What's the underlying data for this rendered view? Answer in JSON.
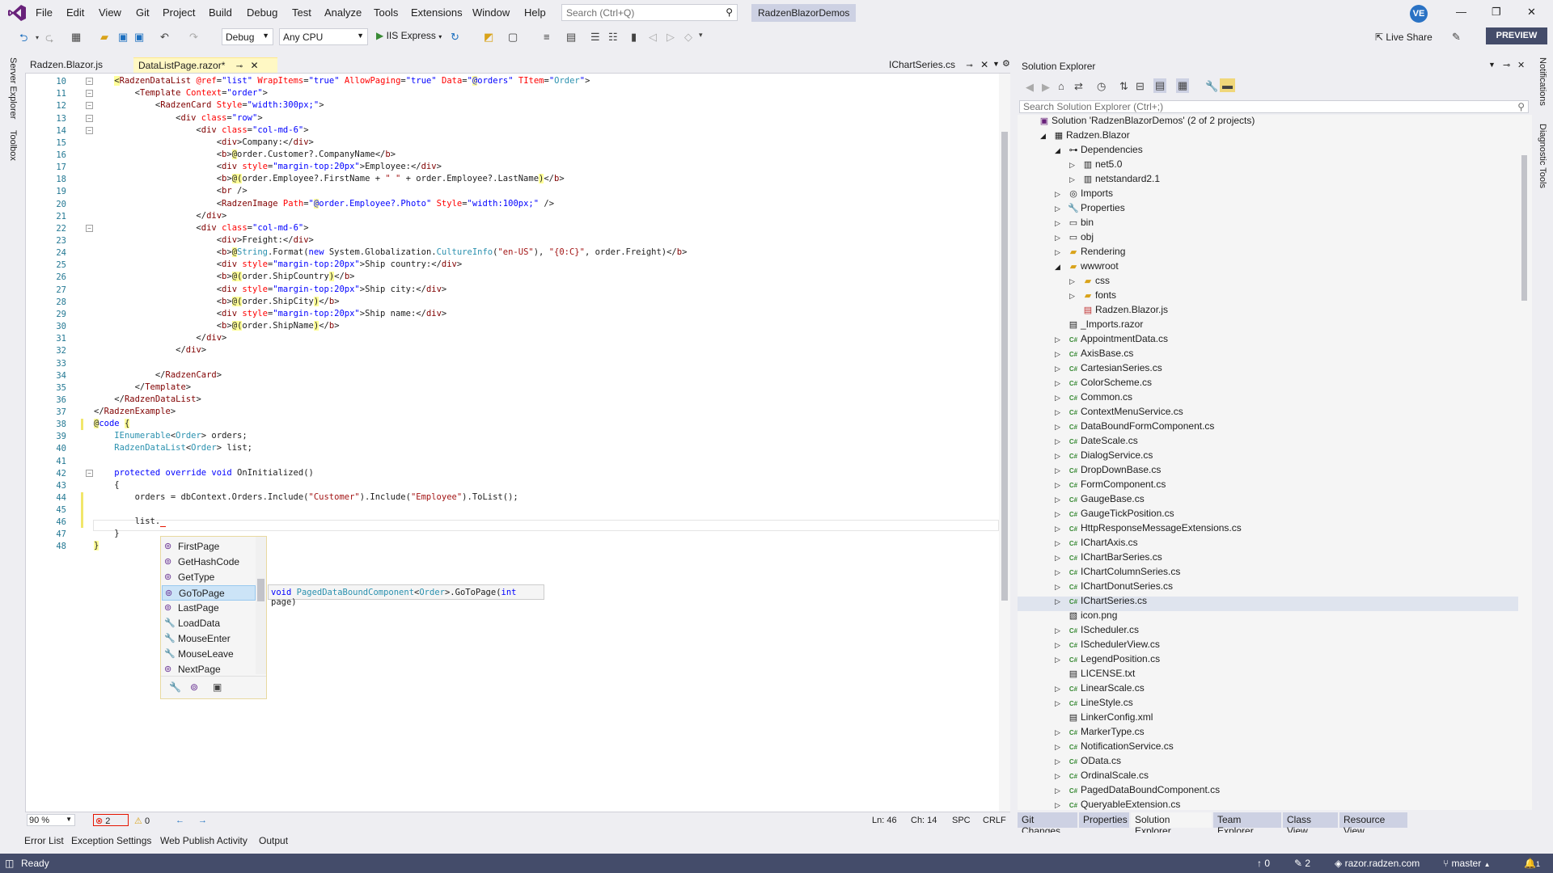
{
  "menu": [
    "File",
    "Edit",
    "View",
    "Git",
    "Project",
    "Build",
    "Debug",
    "Test",
    "Analyze",
    "Tools",
    "Extensions",
    "Window",
    "Help"
  ],
  "search": {
    "placeholder": "Search (Ctrl+Q)"
  },
  "solution_name": "RadzenBlazorDemos",
  "user_initials": "VE",
  "toolbar": {
    "config": "Debug",
    "platform": "Any CPU",
    "run_target": "IIS Express",
    "live_share": "Live Share",
    "preview": "PREVIEW"
  },
  "left_vtabs": [
    "Server Explorer",
    "Toolbox"
  ],
  "right_vtabs": [
    "Notifications",
    "Diagnostic Tools"
  ],
  "editor": {
    "tabs": [
      {
        "label": "Radzen.Blazor.js",
        "active": false
      },
      {
        "label": "DataListPage.razor*",
        "active": true
      },
      {
        "label": "IChartSeries.cs",
        "active": false
      }
    ],
    "line_numbers": [
      "10",
      "11",
      "12",
      "13",
      "14",
      "15",
      "16",
      "17",
      "18",
      "19",
      "20",
      "21",
      "22",
      "23",
      "24",
      "25",
      "26",
      "27",
      "28",
      "29",
      "30",
      "31",
      "32",
      "33",
      "34",
      "35",
      "36",
      "37",
      "38",
      "39",
      "40",
      "41",
      "42",
      "43",
      "44",
      "45",
      "46",
      "47",
      "48"
    ]
  },
  "completion": {
    "items": [
      "FirstPage",
      "GetHashCode",
      "GetType",
      "GoToPage",
      "LastPage",
      "LoadData",
      "MouseEnter",
      "MouseLeave",
      "NextPage"
    ],
    "selected": "GoToPage",
    "tooltip": {
      "ret": "void",
      "cls": "PagedDataBoundComponent",
      "gen": "Order",
      "method": ".GoToPage(",
      "ptype": "int",
      "pname": " page)"
    }
  },
  "editor_status": {
    "zoom": "90 %",
    "errors": "2",
    "warnings": "0",
    "ln": "Ln: 46",
    "ch": "Ch: 14",
    "spc": "SPC",
    "crlf": "CRLF"
  },
  "solution_explorer": {
    "title": "Solution Explorer",
    "search_placeholder": "Search Solution Explorer (Ctrl+;)",
    "nodes": [
      {
        "label": "Solution 'RadzenBlazorDemos' (2 of 2 projects)",
        "depth": 0,
        "icon": "solution-icon",
        "expander": ""
      },
      {
        "label": "Radzen.Blazor",
        "depth": 1,
        "icon": "project-icon",
        "expander": "◢"
      },
      {
        "label": "Dependencies",
        "depth": 2,
        "icon": "dependencies-icon",
        "expander": "◢"
      },
      {
        "label": "net5.0",
        "depth": 3,
        "icon": "framework-icon",
        "expander": "▷"
      },
      {
        "label": "netstandard2.1",
        "depth": 3,
        "icon": "framework-icon",
        "expander": "▷"
      },
      {
        "label": "Imports",
        "depth": 2,
        "icon": "imports-icon",
        "expander": "▷"
      },
      {
        "label": "Properties",
        "depth": 2,
        "icon": "properties-icon",
        "expander": "▷"
      },
      {
        "label": "bin",
        "depth": 2,
        "icon": "folder-outline-icon",
        "expander": "▷"
      },
      {
        "label": "obj",
        "depth": 2,
        "icon": "folder-outline-icon",
        "expander": "▷"
      },
      {
        "label": "Rendering",
        "depth": 2,
        "icon": "folder-icon",
        "expander": "▷"
      },
      {
        "label": "wwwroot",
        "depth": 2,
        "icon": "web-folder-icon",
        "expander": "◢"
      },
      {
        "label": "css",
        "depth": 3,
        "icon": "folder-icon",
        "expander": "▷"
      },
      {
        "label": "fonts",
        "depth": 3,
        "icon": "folder-icon",
        "expander": "▷"
      },
      {
        "label": "Radzen.Blazor.js",
        "depth": 3,
        "icon": "js-file-icon",
        "expander": ""
      },
      {
        "label": "_Imports.razor",
        "depth": 2,
        "icon": "razor-file-icon",
        "expander": ""
      },
      {
        "label": "AppointmentData.cs",
        "depth": 2,
        "icon": "cs-file-icon",
        "expander": "▷"
      },
      {
        "label": "AxisBase.cs",
        "depth": 2,
        "icon": "cs-file-icon",
        "expander": "▷"
      },
      {
        "label": "CartesianSeries.cs",
        "depth": 2,
        "icon": "cs-file-icon",
        "expander": "▷"
      },
      {
        "label": "ColorScheme.cs",
        "depth": 2,
        "icon": "cs-file-icon",
        "expander": "▷"
      },
      {
        "label": "Common.cs",
        "depth": 2,
        "icon": "cs-file-icon",
        "expander": "▷"
      },
      {
        "label": "ContextMenuService.cs",
        "depth": 2,
        "icon": "cs-file-icon",
        "expander": "▷"
      },
      {
        "label": "DataBoundFormComponent.cs",
        "depth": 2,
        "icon": "cs-file-icon",
        "expander": "▷"
      },
      {
        "label": "DateScale.cs",
        "depth": 2,
        "icon": "cs-file-icon",
        "expander": "▷"
      },
      {
        "label": "DialogService.cs",
        "depth": 2,
        "icon": "cs-file-icon",
        "expander": "▷"
      },
      {
        "label": "DropDownBase.cs",
        "depth": 2,
        "icon": "cs-file-icon",
        "expander": "▷"
      },
      {
        "label": "FormComponent.cs",
        "depth": 2,
        "icon": "cs-file-icon",
        "expander": "▷"
      },
      {
        "label": "GaugeBase.cs",
        "depth": 2,
        "icon": "cs-file-icon",
        "expander": "▷"
      },
      {
        "label": "GaugeTickPosition.cs",
        "depth": 2,
        "icon": "cs-file-icon",
        "expander": "▷"
      },
      {
        "label": "HttpResponseMessageExtensions.cs",
        "depth": 2,
        "icon": "cs-file-icon",
        "expander": "▷"
      },
      {
        "label": "IChartAxis.cs",
        "depth": 2,
        "icon": "cs-file-icon",
        "expander": "▷"
      },
      {
        "label": "IChartBarSeries.cs",
        "depth": 2,
        "icon": "cs-file-icon",
        "expander": "▷"
      },
      {
        "label": "IChartColumnSeries.cs",
        "depth": 2,
        "icon": "cs-file-icon",
        "expander": "▷"
      },
      {
        "label": "IChartDonutSeries.cs",
        "depth": 2,
        "icon": "cs-file-icon",
        "expander": "▷"
      },
      {
        "label": "IChartSeries.cs",
        "depth": 2,
        "icon": "cs-file-icon",
        "expander": "▷"
      },
      {
        "label": "icon.png",
        "depth": 2,
        "icon": "image-file-icon",
        "expander": ""
      },
      {
        "label": "IScheduler.cs",
        "depth": 2,
        "icon": "cs-file-icon",
        "expander": "▷"
      },
      {
        "label": "ISchedulerView.cs",
        "depth": 2,
        "icon": "cs-file-icon",
        "expander": "▷"
      },
      {
        "label": "LegendPosition.cs",
        "depth": 2,
        "icon": "cs-file-icon",
        "expander": "▷"
      },
      {
        "label": "LICENSE.txt",
        "depth": 2,
        "icon": "text-file-icon",
        "expander": ""
      },
      {
        "label": "LinearScale.cs",
        "depth": 2,
        "icon": "cs-file-icon",
        "expander": "▷"
      },
      {
        "label": "LineStyle.cs",
        "depth": 2,
        "icon": "cs-file-icon",
        "expander": "▷"
      },
      {
        "label": "LinkerConfig.xml",
        "depth": 2,
        "icon": "xml-file-icon",
        "expander": ""
      },
      {
        "label": "MarkerType.cs",
        "depth": 2,
        "icon": "cs-file-icon",
        "expander": "▷"
      },
      {
        "label": "NotificationService.cs",
        "depth": 2,
        "icon": "cs-file-icon",
        "expander": "▷"
      },
      {
        "label": "OData.cs",
        "depth": 2,
        "icon": "cs-file-icon",
        "expander": "▷"
      },
      {
        "label": "OrdinalScale.cs",
        "depth": 2,
        "icon": "cs-file-icon",
        "expander": "▷"
      },
      {
        "label": "PagedDataBoundComponent.cs",
        "depth": 2,
        "icon": "cs-file-icon",
        "expander": "▷"
      },
      {
        "label": "QueryableExtension.cs",
        "depth": 2,
        "icon": "cs-file-icon",
        "expander": "▷"
      }
    ],
    "tabs": [
      "Git Changes",
      "Properties",
      "Solution Explorer",
      "Team Explorer",
      "Class View",
      "Resource View"
    ],
    "active_tab": "Solution Explorer"
  },
  "bottom_tabs": [
    "Error List",
    "Exception Settings",
    "Web Publish Activity",
    "Output"
  ],
  "statusbar": {
    "ready": "Ready",
    "up": "0",
    "pencil": "2",
    "repo": "razor.radzen.com",
    "branch": "master",
    "bell": "1"
  },
  "colors": {
    "accent": "#68217a",
    "statusbar": "#444c6a"
  }
}
